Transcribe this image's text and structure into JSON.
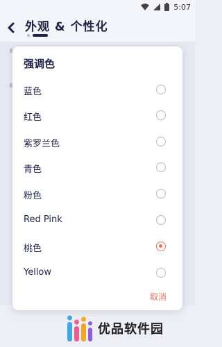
{
  "status_bar": {
    "time": "5:07"
  },
  "header": {
    "title": "外观 & 个性化",
    "back_icon": "chevron-left-icon"
  },
  "dialog": {
    "title": "强调色",
    "options": [
      {
        "label": "蓝色",
        "selected": false
      },
      {
        "label": "红色",
        "selected": false
      },
      {
        "label": "紫罗兰色",
        "selected": false
      },
      {
        "label": "青色",
        "selected": false
      },
      {
        "label": "粉色",
        "selected": false
      },
      {
        "label": "Red Pink",
        "selected": false
      },
      {
        "label": "桃色",
        "selected": true
      },
      {
        "label": "Yellow",
        "selected": false
      }
    ],
    "cancel_label": "取消"
  },
  "watermark": {
    "text": "优品软件园"
  },
  "colors": {
    "accent": "#ef7154",
    "title": "#1f2347",
    "background": "#eeeff5"
  }
}
